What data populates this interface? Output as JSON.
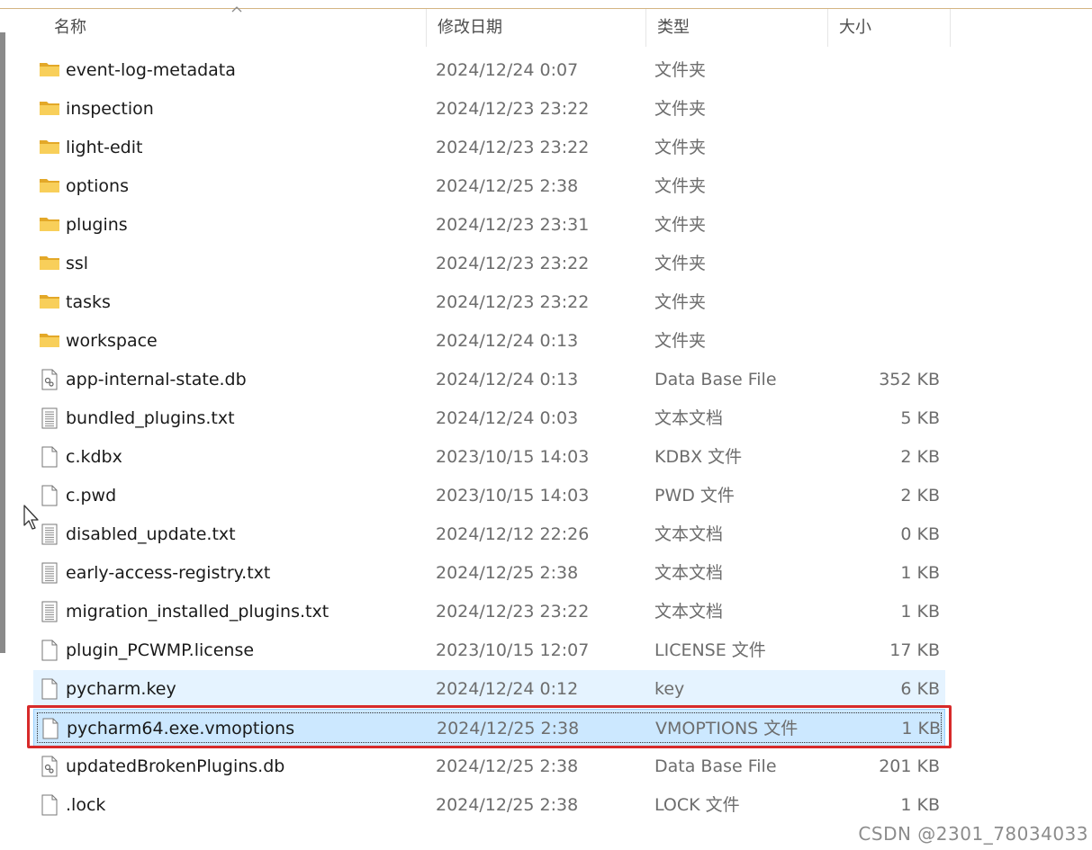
{
  "header": {
    "columns": [
      {
        "label": "名称"
      },
      {
        "label": "修改日期"
      },
      {
        "label": "类型"
      },
      {
        "label": "大小"
      }
    ]
  },
  "files": [
    {
      "name": "event-log-metadata",
      "date": "2024/12/24 0:07",
      "type": "文件夹",
      "size": "",
      "icon": "folder-icon"
    },
    {
      "name": "inspection",
      "date": "2024/12/23 23:22",
      "type": "文件夹",
      "size": "",
      "icon": "folder-icon"
    },
    {
      "name": "light-edit",
      "date": "2024/12/23 23:22",
      "type": "文件夹",
      "size": "",
      "icon": "folder-icon"
    },
    {
      "name": "options",
      "date": "2024/12/25 2:38",
      "type": "文件夹",
      "size": "",
      "icon": "folder-icon"
    },
    {
      "name": "plugins",
      "date": "2024/12/23 23:31",
      "type": "文件夹",
      "size": "",
      "icon": "folder-icon"
    },
    {
      "name": "ssl",
      "date": "2024/12/23 23:22",
      "type": "文件夹",
      "size": "",
      "icon": "folder-icon"
    },
    {
      "name": "tasks",
      "date": "2024/12/23 23:22",
      "type": "文件夹",
      "size": "",
      "icon": "folder-icon"
    },
    {
      "name": "workspace",
      "date": "2024/12/24 0:13",
      "type": "文件夹",
      "size": "",
      "icon": "folder-icon"
    },
    {
      "name": "app-internal-state.db",
      "date": "2024/12/24 0:13",
      "type": "Data Base File",
      "size": "352 KB",
      "icon": "database-file-icon"
    },
    {
      "name": "bundled_plugins.txt",
      "date": "2024/12/24 0:03",
      "type": "文本文档",
      "size": "5 KB",
      "icon": "text-file-icon"
    },
    {
      "name": "c.kdbx",
      "date": "2023/10/15 14:03",
      "type": "KDBX 文件",
      "size": "2 KB",
      "icon": "blank-file-icon"
    },
    {
      "name": "c.pwd",
      "date": "2023/10/15 14:03",
      "type": "PWD 文件",
      "size": "2 KB",
      "icon": "blank-file-icon"
    },
    {
      "name": "disabled_update.txt",
      "date": "2024/12/12 22:26",
      "type": "文本文档",
      "size": "0 KB",
      "icon": "text-file-icon"
    },
    {
      "name": "early-access-registry.txt",
      "date": "2024/12/25 2:38",
      "type": "文本文档",
      "size": "1 KB",
      "icon": "text-file-icon"
    },
    {
      "name": "migration_installed_plugins.txt",
      "date": "2024/12/23 23:22",
      "type": "文本文档",
      "size": "1 KB",
      "icon": "text-file-icon"
    },
    {
      "name": "plugin_PCWMP.license",
      "date": "2023/10/15 12:07",
      "type": "LICENSE 文件",
      "size": "17 KB",
      "icon": "blank-file-icon"
    },
    {
      "name": "pycharm.key",
      "date": "2024/12/24 0:12",
      "type": "key",
      "size": "6 KB",
      "icon": "blank-file-icon"
    },
    {
      "name": "pycharm64.exe.vmoptions",
      "date": "2024/12/25 2:38",
      "type": "VMOPTIONS 文件",
      "size": "1 KB",
      "icon": "blank-file-icon"
    },
    {
      "name": "updatedBrokenPlugins.db",
      "date": "2024/12/25 2:38",
      "type": "Data Base File",
      "size": "201 KB",
      "icon": "database-file-icon"
    },
    {
      "name": ".lock",
      "date": "2024/12/25 2:38",
      "type": "LOCK 文件",
      "size": "1 KB",
      "icon": "blank-file-icon"
    }
  ],
  "state": {
    "hovered_row": "pycharm.key",
    "selected_row": "pycharm64.exe.vmoptions"
  },
  "watermark": "CSDN @2301_78034033",
  "colors": {
    "highlight_box": "#d72a2a",
    "selection": "#cce8ff",
    "hover": "#e5f3ff",
    "folder": "#f6c344"
  }
}
